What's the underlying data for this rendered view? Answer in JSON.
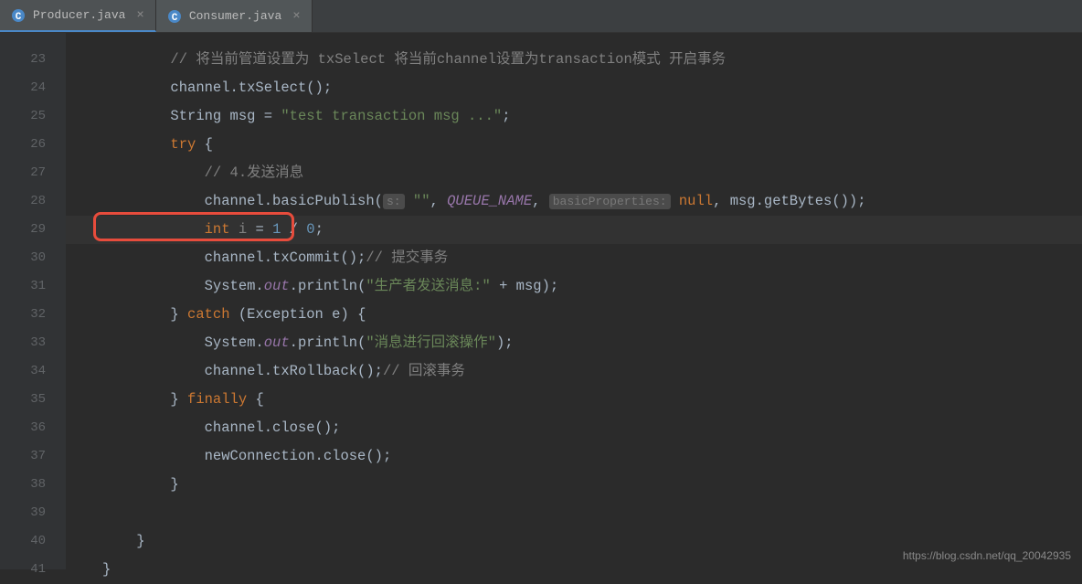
{
  "tabs": [
    {
      "label": "Producer.java",
      "active": true
    },
    {
      "label": "Consumer.java",
      "active": false
    }
  ],
  "lineNumbers": [
    "23",
    "24",
    "25",
    "26",
    "27",
    "28",
    "29",
    "30",
    "31",
    "32",
    "33",
    "34",
    "35",
    "36",
    "37",
    "38",
    "39",
    "40",
    "41"
  ],
  "code": {
    "l23": {
      "indent": "        ",
      "comment": "// 将当前管道设置为 txSelect 将当前channel设置为transaction模式 开启事务"
    },
    "l24": {
      "indent": "        ",
      "t1": "channel.txSelect();"
    },
    "l25": {
      "indent": "        ",
      "type": "String ",
      "var": "msg = ",
      "str": "\"test transaction msg ...\"",
      "end": ";"
    },
    "l26": {
      "indent": "        ",
      "kw": "try ",
      "brace": "{"
    },
    "l27": {
      "indent": "            ",
      "comment": "// 4.发送消息"
    },
    "l28": {
      "indent": "            ",
      "t1": "channel.basicPublish(",
      "hint1": "s:",
      "sp1": " ",
      "str1": "\"\"",
      "t2": ", ",
      "field": "QUEUE_NAME",
      "t3": ", ",
      "hint2": "basicProperties:",
      "sp2": " ",
      "kw": "null",
      "t4": ", msg.getBytes());"
    },
    "l29": {
      "indent": "            ",
      "kw": "int ",
      "var": "i",
      "eq": " = ",
      "n1": "1",
      "op": " / ",
      "n2": "0",
      "end": ";"
    },
    "l30": {
      "indent": "            ",
      "t1": "channel.txCommit();",
      "comment": "// 提交事务"
    },
    "l31": {
      "indent": "            ",
      "t1": "System.",
      "field": "out",
      "t2": ".println(",
      "str": "\"生产者发送消息:\"",
      "t3": " + msg);"
    },
    "l32": {
      "indent": "        ",
      "t1": "} ",
      "kw": "catch ",
      "t2": "(Exception e) {"
    },
    "l33": {
      "indent": "            ",
      "t1": "System.",
      "field": "out",
      "t2": ".println(",
      "str": "\"消息进行回滚操作\"",
      "t3": ");"
    },
    "l34": {
      "indent": "            ",
      "t1": "channel.txRollback();",
      "comment": "// 回滚事务"
    },
    "l35": {
      "indent": "        ",
      "t1": "} ",
      "kw": "finally ",
      "t2": "{"
    },
    "l36": {
      "indent": "            ",
      "t1": "channel.close();"
    },
    "l37": {
      "indent": "            ",
      "t1": "newConnection.close();"
    },
    "l38": {
      "indent": "        ",
      "t1": "}"
    },
    "l39": {
      "indent": ""
    },
    "l40": {
      "indent": "    ",
      "t1": "}"
    },
    "l41": {
      "indent": "",
      "t1": "}"
    }
  },
  "watermark": "https://blog.csdn.net/qq_20042935"
}
